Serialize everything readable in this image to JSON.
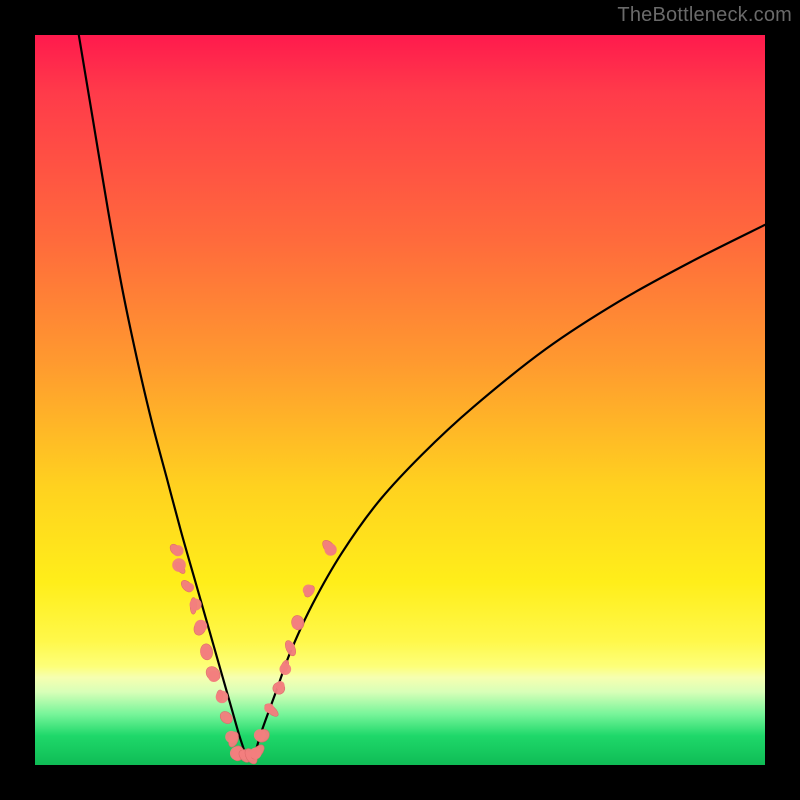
{
  "attribution": "TheBottleneck.com",
  "chart_data": {
    "type": "line",
    "title": "",
    "xlabel": "",
    "ylabel": "",
    "xlim": [
      0,
      100
    ],
    "ylim": [
      0,
      100
    ],
    "series": [
      {
        "name": "left-branch",
        "x": [
          6,
          8,
          10,
          12,
          14,
          16,
          18,
          20,
          22,
          23,
          24,
          25,
          26,
          27,
          28,
          29
        ],
        "y": [
          100,
          88,
          76,
          65,
          55.5,
          47,
          39.5,
          32,
          25,
          21.5,
          18,
          14.5,
          11,
          7.5,
          4,
          1
        ]
      },
      {
        "name": "right-branch",
        "x": [
          30,
          31,
          33,
          35,
          38,
          42,
          47,
          53,
          60,
          70,
          80,
          90,
          100
        ],
        "y": [
          1,
          4.5,
          10,
          15.5,
          22,
          29,
          36,
          42.5,
          49,
          57,
          63.5,
          69,
          74
        ]
      }
    ],
    "marker_clusters": [
      {
        "name": "left-cluster",
        "approx_points": [
          {
            "x": 19.2,
            "y": 29.5
          },
          {
            "x": 19.9,
            "y": 27.0
          },
          {
            "x": 20.8,
            "y": 24.5
          },
          {
            "x": 21.7,
            "y": 21.8
          },
          {
            "x": 22.6,
            "y": 18.8
          },
          {
            "x": 23.5,
            "y": 15.5
          },
          {
            "x": 24.4,
            "y": 12.5
          },
          {
            "x": 25.3,
            "y": 9.5
          },
          {
            "x": 26.2,
            "y": 6.5
          },
          {
            "x": 27.2,
            "y": 3.5
          }
        ]
      },
      {
        "name": "bottom-cluster",
        "approx_points": [
          {
            "x": 27.8,
            "y": 1.6
          },
          {
            "x": 28.7,
            "y": 1.2
          },
          {
            "x": 29.6,
            "y": 1.2
          },
          {
            "x": 30.5,
            "y": 1.8
          }
        ]
      },
      {
        "name": "right-cluster",
        "approx_points": [
          {
            "x": 31.2,
            "y": 4.0
          },
          {
            "x": 32.4,
            "y": 7.5
          },
          {
            "x": 33.4,
            "y": 10.5
          },
          {
            "x": 34.2,
            "y": 13.5
          },
          {
            "x": 35.0,
            "y": 16.0
          },
          {
            "x": 36.0,
            "y": 19.5
          },
          {
            "x": 37.6,
            "y": 23.8
          },
          {
            "x": 40.3,
            "y": 29.8
          }
        ]
      }
    ],
    "colors": {
      "curve": "#000000",
      "marker_fill": "#f27e7e",
      "marker_stroke": "#de6a6a"
    }
  }
}
